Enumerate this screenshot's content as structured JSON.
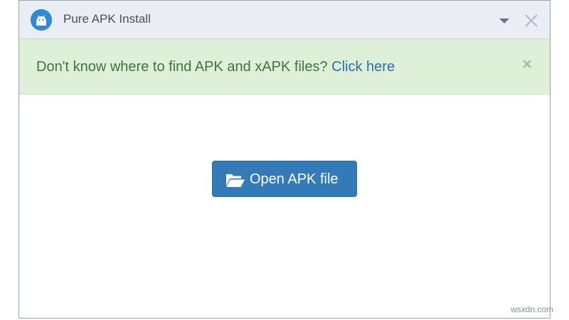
{
  "window": {
    "title": "Pure APK Install",
    "app_icon": "android-robot-icon",
    "menu_icon": "caret-down-icon",
    "close_icon": "close-icon"
  },
  "notice": {
    "text": "Don't know where to find APK and xAPK files?",
    "link_label": "Click here",
    "close_icon": "close-icon",
    "background": "#dff0d8",
    "text_color": "#3c763d",
    "link_color": "#2a6fb0"
  },
  "main": {
    "open_button": {
      "label": "Open APK file",
      "icon": "folder-open-icon",
      "color": "#337ab7"
    }
  },
  "watermark": {
    "text": "wsxdn.com"
  }
}
